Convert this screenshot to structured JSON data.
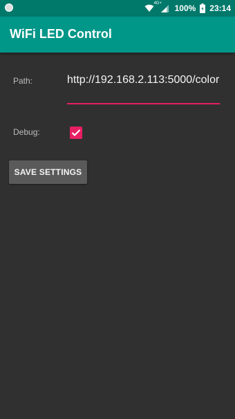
{
  "status_bar": {
    "signal_label": "4G+",
    "battery": "100%",
    "time": "23:14",
    "icons": [
      "notification-dot-icon",
      "wifi-icon",
      "cell-signal-icon",
      "battery-icon"
    ]
  },
  "app_bar": {
    "title": "WiFi LED Control",
    "color": "#009688"
  },
  "settings": {
    "path_label": "Path:",
    "path_value": "http://192.168.2.113:5000/color",
    "debug_label": "Debug:",
    "debug_checked": true,
    "save_label": "SAVE SETTINGS"
  },
  "colors": {
    "accent": "#e91e63",
    "primary_dark": "#00796b",
    "background": "#303030"
  }
}
